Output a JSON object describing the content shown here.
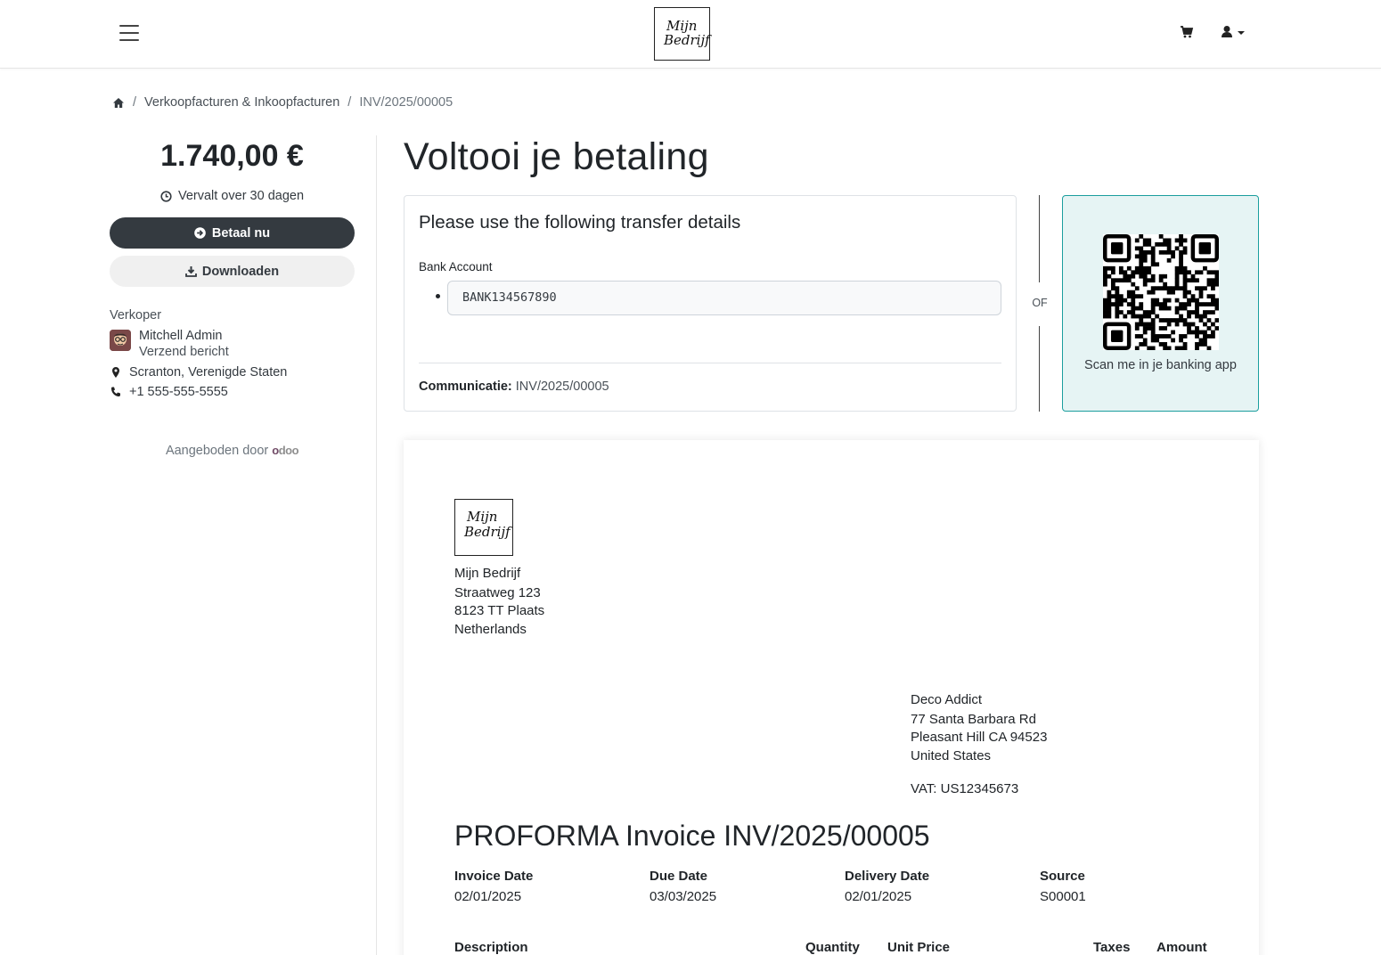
{
  "header": {
    "logo_line1": "Mijn",
    "logo_line2": "Bedrijf"
  },
  "breadcrumb": {
    "items": [
      "Verkoopfacturen & Inkoopfacturen",
      "INV/2025/00005"
    ]
  },
  "sidebar": {
    "amount": "1.740,00 €",
    "due": "Vervalt over 30 dagen",
    "pay_label": "Betaal nu",
    "download_label": "Downloaden",
    "seller_label": "Verkoper",
    "seller_name": "Mitchell Admin",
    "seller_message": "Verzend bericht",
    "location": "Scranton, Verenigde Staten",
    "phone": "+1 555-555-5555",
    "powered_by": "Aangeboden door",
    "powered_brand": "odoo"
  },
  "main": {
    "title": "Voltooi je betaling",
    "transfer": {
      "title": "Please use the following transfer details",
      "bank_label": "Bank Account",
      "bank_account": "BANK134567890",
      "communication_label": "Communicatie:",
      "communication_value": "INV/2025/00005"
    },
    "or_text": "OF",
    "qr_caption": "Scan me in je banking app"
  },
  "invoice": {
    "company": [
      "Mijn Bedrijf",
      "Straatweg 123",
      "8123 TT Plaats",
      "Netherlands"
    ],
    "customer": [
      "Deco Addict",
      "77 Santa Barbara Rd",
      "Pleasant Hill CA 94523",
      "United States"
    ],
    "vat": "VAT: US12345673",
    "title": "PROFORMA Invoice INV/2025/00005",
    "meta": [
      {
        "label": "Invoice Date",
        "value": "02/01/2025"
      },
      {
        "label": "Due Date",
        "value": "03/03/2025"
      },
      {
        "label": "Delivery Date",
        "value": "02/01/2025"
      },
      {
        "label": "Source",
        "value": "S00001"
      }
    ],
    "columns": [
      "Description",
      "Quantity",
      "Unit Price",
      "Taxes",
      "Amount"
    ]
  },
  "colors": {
    "primary_dark": "#343a40",
    "qr_border": "#1b9e9e",
    "qr_bg": "#e6f4f4"
  },
  "icons": [
    "menu-icon",
    "cart-icon",
    "user-icon",
    "home-icon",
    "clock-icon",
    "arrow-circle-right-icon",
    "download-icon",
    "map-marker-icon",
    "phone-icon"
  ]
}
